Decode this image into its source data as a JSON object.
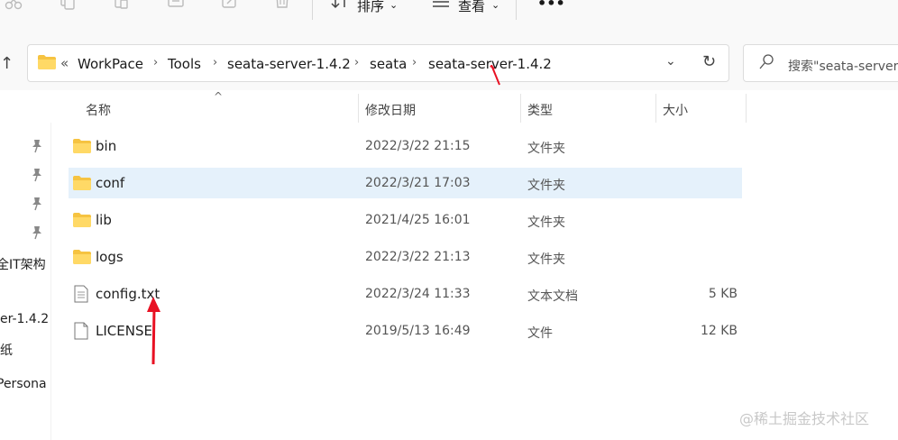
{
  "toolbar": {
    "sort_label": "排序",
    "view_label": "查看",
    "more_label": "•••"
  },
  "breadcrumb": {
    "overflow": "«",
    "items": [
      "WorkPace",
      "Tools",
      "seata-server-1.4.2",
      "seata",
      "seata-server-1.4.2"
    ],
    "separator": "›"
  },
  "search": {
    "placeholder": "搜索\"seata-server"
  },
  "columns": {
    "name": "名称",
    "date": "修改日期",
    "type": "类型",
    "size": "大小"
  },
  "files": [
    {
      "name": "bin",
      "date": "2022/3/22 21:15",
      "type": "文件夹",
      "size": "",
      "kind": "folder",
      "selected": false
    },
    {
      "name": "conf",
      "date": "2022/3/21 17:03",
      "type": "文件夹",
      "size": "",
      "kind": "folder",
      "selected": true
    },
    {
      "name": "lib",
      "date": "2021/4/25 16:01",
      "type": "文件夹",
      "size": "",
      "kind": "folder",
      "selected": false
    },
    {
      "name": "logs",
      "date": "2022/3/22 21:13",
      "type": "文件夹",
      "size": "",
      "kind": "folder",
      "selected": false
    },
    {
      "name": "config.txt",
      "date": "2022/3/24 11:33",
      "type": "文本文档",
      "size": "5 KB",
      "kind": "text",
      "selected": false
    },
    {
      "name": "LICENSE",
      "date": "2019/5/13 16:49",
      "type": "文件",
      "size": "12 KB",
      "kind": "file",
      "selected": false
    }
  ],
  "nav": {
    "items": [
      "全IT架构",
      "er-1.4.2",
      "纸",
      "Persona"
    ]
  },
  "watermark": "@稀土掘金技术社区",
  "colors": {
    "accent": "#e81123",
    "selection": "#e5f1fb",
    "folder": "#f6c341"
  }
}
